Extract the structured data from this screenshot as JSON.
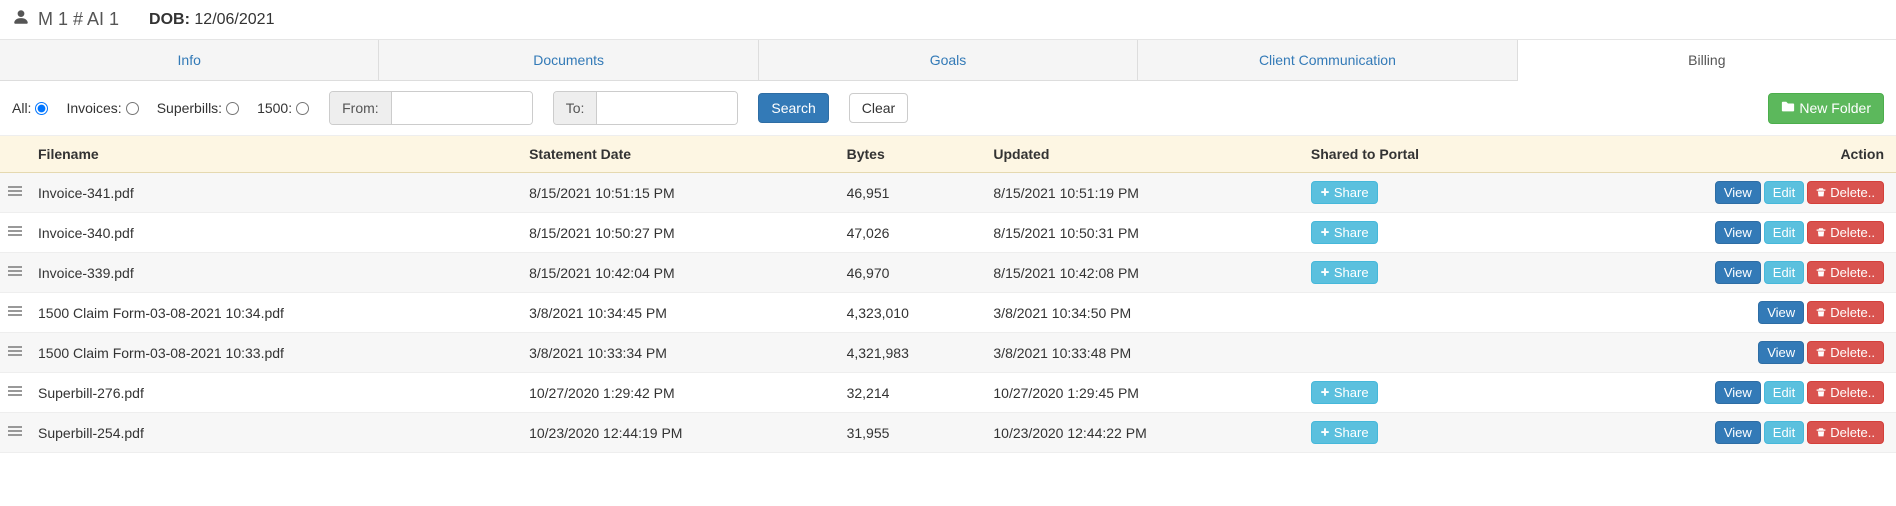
{
  "header": {
    "client_name": "M 1 # AI 1",
    "dob_label": "DOB:",
    "dob_value": "12/06/2021"
  },
  "tabs": [
    {
      "label": "Info",
      "active": false
    },
    {
      "label": "Documents",
      "active": false
    },
    {
      "label": "Goals",
      "active": false
    },
    {
      "label": "Client Communication",
      "active": false
    },
    {
      "label": "Billing",
      "active": true
    }
  ],
  "filters": {
    "radios": [
      {
        "label": "All:",
        "checked": true
      },
      {
        "label": "Invoices:",
        "checked": false
      },
      {
        "label": "Superbills:",
        "checked": false
      },
      {
        "label": "1500:",
        "checked": false
      }
    ],
    "from_label": "From:",
    "from_value": "",
    "to_label": "To:",
    "to_value": "",
    "search_label": "Search",
    "clear_label": "Clear",
    "new_folder_label": "New Folder"
  },
  "table": {
    "headers": [
      "",
      "Filename",
      "Statement Date",
      "Bytes",
      "Updated",
      "Shared to Portal",
      "Action"
    ],
    "share_label": "Share",
    "view_label": "View",
    "edit_label": "Edit",
    "delete_label": "Delete..",
    "rows": [
      {
        "filename": "Invoice-341.pdf",
        "statement_date": "8/15/2021 10:51:15 PM",
        "bytes": "46,951",
        "updated": "8/15/2021 10:51:19 PM",
        "has_share": true,
        "has_edit": true
      },
      {
        "filename": "Invoice-340.pdf",
        "statement_date": "8/15/2021 10:50:27 PM",
        "bytes": "47,026",
        "updated": "8/15/2021 10:50:31 PM",
        "has_share": true,
        "has_edit": true
      },
      {
        "filename": "Invoice-339.pdf",
        "statement_date": "8/15/2021 10:42:04 PM",
        "bytes": "46,970",
        "updated": "8/15/2021 10:42:08 PM",
        "has_share": true,
        "has_edit": true
      },
      {
        "filename": "1500 Claim Form-03-08-2021 10:34.pdf",
        "statement_date": "3/8/2021 10:34:45 PM",
        "bytes": "4,323,010",
        "updated": "3/8/2021 10:34:50 PM",
        "has_share": false,
        "has_edit": false
      },
      {
        "filename": "1500 Claim Form-03-08-2021 10:33.pdf",
        "statement_date": "3/8/2021 10:33:34 PM",
        "bytes": "4,321,983",
        "updated": "3/8/2021 10:33:48 PM",
        "has_share": false,
        "has_edit": false
      },
      {
        "filename": "Superbill-276.pdf",
        "statement_date": "10/27/2020 1:29:42 PM",
        "bytes": "32,214",
        "updated": "10/27/2020 1:29:45 PM",
        "has_share": true,
        "has_edit": true
      },
      {
        "filename": "Superbill-254.pdf",
        "statement_date": "10/23/2020 12:44:19 PM",
        "bytes": "31,955",
        "updated": "10/23/2020 12:44:22 PM",
        "has_share": true,
        "has_edit": true
      }
    ]
  }
}
